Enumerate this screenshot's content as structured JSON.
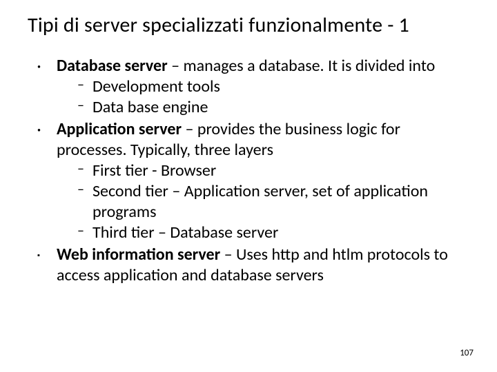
{
  "title": "Tipi di server specializzati funzionalmente - 1",
  "items": [
    {
      "marker": "dot",
      "bold": "Database server",
      "rest": " – manages a database. It is divided into",
      "sub": [
        "Development tools",
        "Data base engine"
      ]
    },
    {
      "marker": "dot",
      "bold": "Application server",
      "rest": " – provides the business logic for processes. Typically, three layers",
      "sub": [
        " First tier - Browser",
        "Second tier – Application server, set of application programs",
        "Third tier – Database server"
      ]
    },
    {
      "marker": "sq",
      "bold": "Web information server",
      "rest": " – Uses http and htlm protocols to access application and database servers",
      "sub": []
    }
  ],
  "page_number": "107"
}
